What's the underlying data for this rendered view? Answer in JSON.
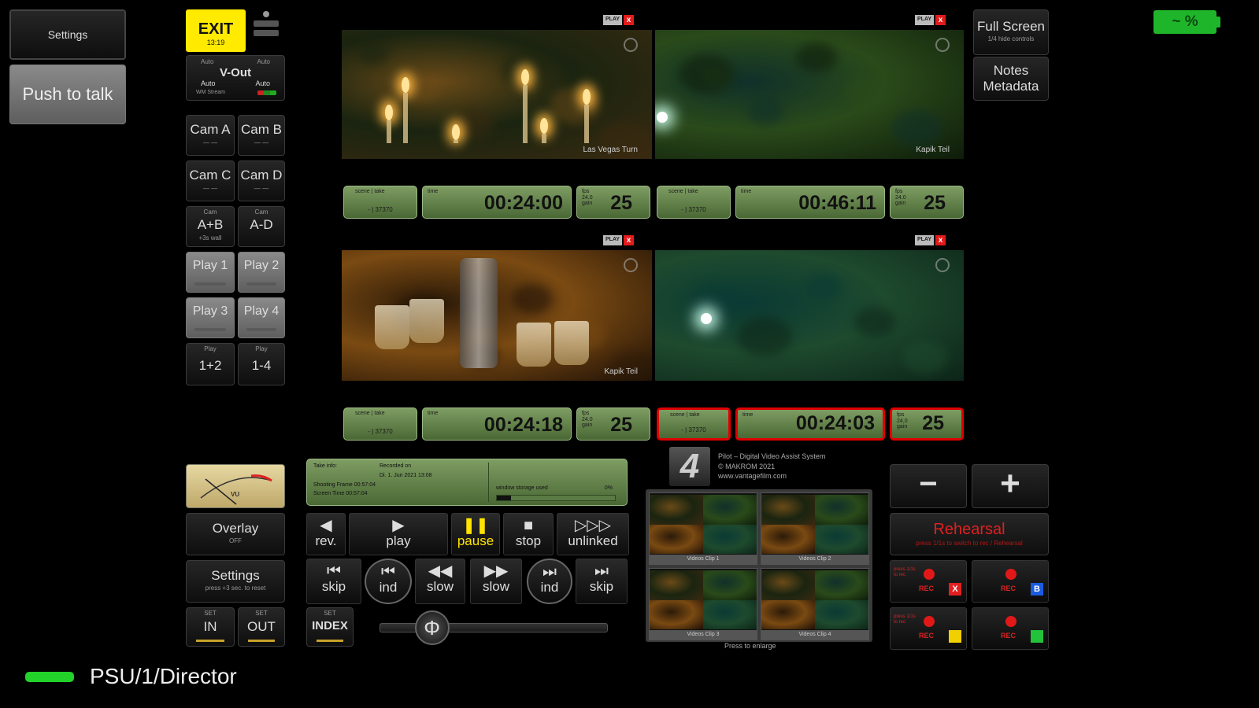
{
  "top_left": {
    "settings_label": "Settings",
    "push_to_talk_label": "Push to talk"
  },
  "exit": {
    "label": "EXIT",
    "time": "13:19"
  },
  "vout": {
    "label": "V-Out",
    "left_top": "Auto",
    "right_top": "Auto",
    "left_bottom": "Auto",
    "right_bottom": "Auto",
    "note": "WM Stream"
  },
  "cam_buttons": [
    {
      "label": "Cam A",
      "sub": "— —"
    },
    {
      "label": "Cam B",
      "sub": "— —"
    },
    {
      "label": "Cam C",
      "sub": "— —"
    },
    {
      "label": "Cam D",
      "sub": "— —"
    },
    {
      "top": "Cam",
      "label": "A+B",
      "sub": "+3s wall"
    },
    {
      "top": "Cam",
      "label": "A-D",
      "sub": ""
    }
  ],
  "play_buttons": [
    {
      "label": "Play 1"
    },
    {
      "label": "Play 2"
    },
    {
      "label": "Play 3"
    },
    {
      "label": "Play 4"
    }
  ],
  "multi_play": [
    {
      "top": "Play",
      "label": "1+2"
    },
    {
      "top": "Play",
      "label": "1-4"
    }
  ],
  "videos": [
    {
      "caption": "Las Vegas Turn",
      "play_tag": "PLAY",
      "close": "x",
      "colors": [
        "#3a2a10",
        "#1a2410",
        "#6a4a18"
      ]
    },
    {
      "caption": "Kapik Teil",
      "play_tag": "PLAY",
      "close": "x",
      "colors": [
        "#0e1c0a",
        "#2a4a1a",
        "#10302a"
      ]
    },
    {
      "caption": "Kapik Teil",
      "play_tag": "PLAY",
      "close": "x",
      "colors": [
        "#1e1006",
        "#7a4a12",
        "#2c1a08"
      ]
    },
    {
      "caption": "",
      "play_tag": "PLAY",
      "close": "x",
      "colors": [
        "#0c2418",
        "#1e4a2e",
        "#0a3a34"
      ]
    }
  ],
  "timecodes": [
    {
      "scene_label": "scene | take",
      "scene_value": "- | 37370",
      "time_label": "time",
      "time": "00:24:00",
      "fps_label": "fps 24.0 gain",
      "fps": "25",
      "highlight": false
    },
    {
      "scene_label": "scene | take",
      "scene_value": "- | 37370",
      "time_label": "time",
      "time": "00:46:11",
      "fps_label": "fps 24.0 gain",
      "fps": "25",
      "highlight": false
    },
    {
      "scene_label": "scene | take",
      "scene_value": "- | 37370",
      "time_label": "time",
      "time": "00:24:18",
      "fps_label": "fps 24.0 gain",
      "fps": "25",
      "highlight": false
    },
    {
      "scene_label": "scene | take",
      "scene_value": "- | 37370",
      "time_label": "time",
      "time": "00:24:03",
      "fps_label": "fps 24.0 gain",
      "fps": "25",
      "highlight": true
    }
  ],
  "right_top": {
    "fullscreen_label": "Full Screen",
    "fullscreen_sub": "1/4 hide controls",
    "notes_label": "Notes",
    "metadata_label": "Metadata"
  },
  "battery": {
    "label": "~ %",
    "color": "#1fb52a"
  },
  "lower_left": {
    "meter_label": "VU",
    "overlay_label": "Overlay",
    "overlay_sub": "OFF",
    "settings_label": "Settings",
    "settings_sub": "press +3 sec. to reset",
    "in_label": "IN",
    "in_top": "SET",
    "out_label": "OUT",
    "out_top": "SET"
  },
  "take_info": {
    "title": "Take info:",
    "recorded_label": "Recorded on",
    "recorded_value": "Di. 1. Jun 2021  13:08",
    "shooting_label": "Shooting Frame 00:57:04",
    "screen_label": "Screen Time 00:57:04",
    "storage_label": "window storage used",
    "storage_pct": "0%",
    "storage_fraction": 0.12
  },
  "transport_row1": [
    {
      "icon": "◀",
      "label": "rev.",
      "name": "rev-button",
      "active": false
    },
    {
      "icon": "▶",
      "label": "play",
      "name": "play-button",
      "active": false
    },
    {
      "icon": "❚❚",
      "label": "pause",
      "name": "pause-button",
      "active": true
    },
    {
      "icon": "■",
      "label": "stop",
      "name": "stop-button",
      "active": false
    },
    {
      "icon": "▷▷▷",
      "label": "unlinked",
      "name": "unlinked-button",
      "active": false
    }
  ],
  "transport_row2": [
    {
      "icon": "⏮",
      "label": "skip",
      "name": "skip-back-button"
    },
    {
      "icon": "⏮",
      "label": "ind",
      "name": "index-back-button"
    },
    {
      "icon": "◀◀",
      "label": "slow",
      "name": "slow-back-button"
    },
    {
      "icon": "▶▶",
      "label": "slow",
      "name": "slow-forward-button"
    },
    {
      "icon": "⏭",
      "label": "ind",
      "name": "index-forward-button"
    },
    {
      "icon": "⏭",
      "label": "skip",
      "name": "skip-forward-button"
    }
  ],
  "index": {
    "label": "INDEX",
    "top": "SET"
  },
  "scrub": {
    "position": 0.1
  },
  "brand": {
    "logo": "4",
    "line1": "Pilot – Digital Video Assist System",
    "line2": "© MAKROM 2021",
    "line3": "www.vantagefilm.com"
  },
  "thumbnails": [
    {
      "caption": "Videos Clip 1"
    },
    {
      "caption": "Videos Clip 2"
    },
    {
      "caption": "Videos Clip 3"
    },
    {
      "caption": "Videos Clip 4"
    }
  ],
  "thumb_note": "Press to enlarge",
  "zoom": {
    "minus": "−",
    "plus": "+"
  },
  "rehearsal": {
    "label": "Rehearsal",
    "sub": "press 1/1s to switch to rec / Rehearsal"
  },
  "rec_buttons": [
    {
      "rec": "REC",
      "badge": "X",
      "badge_color": "#e02020",
      "note": "press 1/1s to rec"
    },
    {
      "rec": "REC",
      "badge": "B",
      "badge_color": "#1a5be0",
      "note": ""
    },
    {
      "rec": "REC",
      "badge": "",
      "badge_color": "#f0d000",
      "note": "press 1/1s to rec"
    },
    {
      "rec": "REC",
      "badge": "",
      "badge_color": "#22c23a",
      "note": ""
    }
  ],
  "status": {
    "label": "PSU/1/Director",
    "indicator_color": "#22d22a"
  }
}
